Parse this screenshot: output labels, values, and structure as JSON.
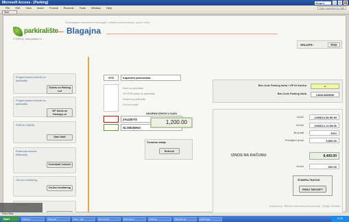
{
  "window": {
    "title": "Microsoft Access - [Parking]",
    "search": "skupni",
    "help_placeholder": "Type a question for help"
  },
  "menu": [
    "File",
    "Edit",
    "View",
    "Insert",
    "Format",
    "Records",
    "Tools",
    "Window",
    "Help"
  ],
  "toolbar": {
    "start": "Start"
  },
  "brand": {
    "logo": "parkiralište",
    "sub": "© 2009 by: www.jajastvo.hr",
    "tagline": "Mi prestigemo konkurentne tehnologije u oblasti kontrole pristupa i javnih vozila*"
  },
  "page": {
    "title": "Blagajna"
  },
  "valuta": {
    "label": "VALUTA:",
    "value": "RSD"
  },
  "sidebar": [
    {
      "label": "Pregled karata izvršenih na parkiralištu",
      "button": "Tickets on Parking Lot"
    },
    {
      "label": "Pregled karata izvršenih na parkiralištu",
      "button": "VIP Cards on Parking Lot"
    },
    {
      "label": "PREKID SMENE:",
      "button": "Start Shift"
    },
    {
      "label": "Evidencija kontrola (ilišavanje)",
      "button": "Command Console"
    },
    {
      "label": "ON-Line monitoring",
      "button": "On-line monitoring"
    },
    {
      "label": "Kraj smene:",
      "button": "End of Shift"
    }
  ],
  "parking": {
    "number": "STR",
    "name": "Kapacitet parkirališta"
  },
  "info_lines": [
    "Karte na parkiralištu",
    "VIP RFID kartice na parkiralištu",
    "Dolazni na parkiralište",
    "Cilni na brojnici"
  ],
  "status": {
    "occupied": "ZAUZETO",
    "free": "SLOBODNO"
  },
  "total": {
    "label": "UKUPAN IZNOS U KASI",
    "value": "1,200.00"
  },
  "trenutno": {
    "label": "Trenutno stanje",
    "button": "Refresh"
  },
  "barcode": {
    "card_label": "Bar-Code Parking karta / VIP ID Kartica",
    "card_value": "**",
    "ticket_label": "Bar-Code Parking karta",
    "ticket_value": "140814085655"
  },
  "details": {
    "ulaz_label": "ULAZ",
    "ulaz_value": "14/08/14 08:56:55",
    "izlaz_label": "IZLAZ",
    "izlaz_value": "25/09/14 12:08:06",
    "sati_label": "Broj sati",
    "sati_value": "1012",
    "prihod_label": "Prirodjeni iznos",
    "prihod_value": "9,800.00",
    "iznos_label": "IZNOS NA RAČUNU",
    "iznos_value": "8,400.00",
    "kusur_label": "Kusur",
    "kusur_value": "600.00"
  },
  "print": {
    "label": "ŠTAMPAJ RAČUN",
    "button": "PRINT RECEIPT"
  },
  "footer": "Sva prava je: \"Bahi-ab Komunalno urbo-prezenja\" - Design: Sebastic",
  "statusbar": "Form View",
  "taskbar": {
    "start": "Start",
    "items": [
      "Parking...",
      "Microsoft",
      "Inbox - Mic",
      "Documents",
      "Microsoft A",
      "Parking...",
      "Windows Ex",
      "Start Page"
    ],
    "clock": "11:25"
  },
  "colors": {
    "accent": "#2f5fa0",
    "logo_green": "#4a8a1c",
    "divider": "#f0a040"
  }
}
